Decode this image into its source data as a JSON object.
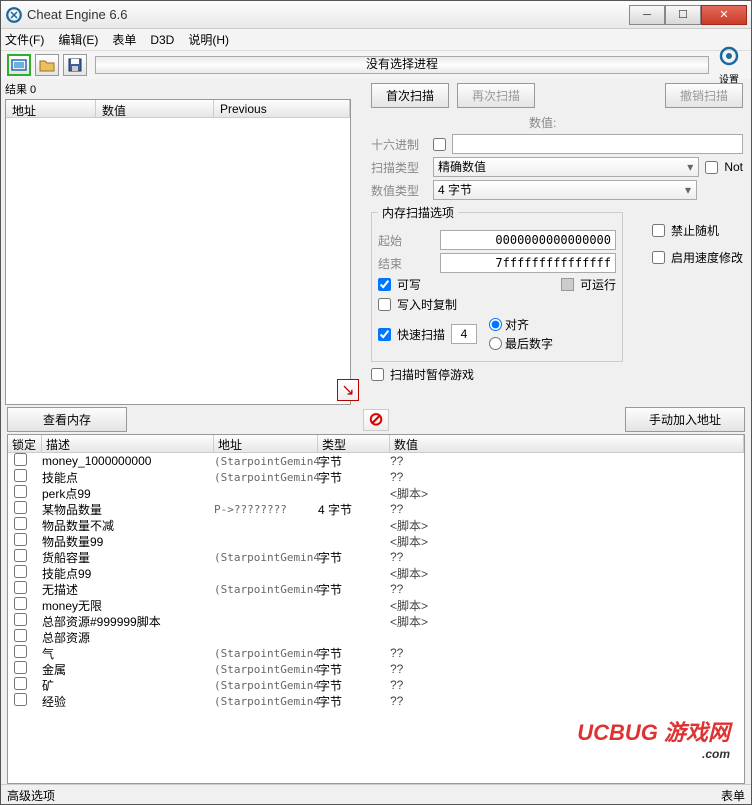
{
  "window": {
    "title": "Cheat Engine 6.6"
  },
  "menu": {
    "file": "文件(F)",
    "edit": "编辑(E)",
    "table": "表单",
    "d3d": "D3D",
    "help": "说明(H)"
  },
  "toolbar": {
    "progress_text": "没有选择进程",
    "settings": "设置"
  },
  "results": {
    "label": "结果 0",
    "col_addr": "地址",
    "col_val": "数值",
    "col_prev": "Previous"
  },
  "scan": {
    "first": "首次扫描",
    "next": "再次扫描",
    "undo": "撤销扫描",
    "value_label": "数值:",
    "hex": "十六进制",
    "scantype_label": "扫描类型",
    "scantype_value": "精确数值",
    "valuetype_label": "数值类型",
    "valuetype_value": "4 字节",
    "not": "Not",
    "mem_legend": "内存扫描选项",
    "start_label": "起始",
    "start_value": "0000000000000000",
    "stop_label": "结束",
    "stop_value": "7fffffffffffffff",
    "writable": "可写",
    "executable": "可运行",
    "copyonwrite": "写入时复制",
    "fastscan": "快速扫描",
    "fastscan_val": "4",
    "align": "对齐",
    "lastdigit": "最后数字",
    "pause": "扫描时暂停游戏",
    "norandom": "禁止随机",
    "speedhack": "启用速度修改"
  },
  "bottom": {
    "view_mem": "查看内存",
    "add_manual": "手动加入地址"
  },
  "cheat_table": {
    "hdr_lock": "锁定",
    "hdr_desc": "描述",
    "hdr_addr": "地址",
    "hdr_type": "类型",
    "hdr_val": "数值",
    "rows": [
      {
        "indent": 0,
        "desc": "money_1000000000",
        "addr": "(StarpointGemin4",
        "type": "字节",
        "val": "??"
      },
      {
        "indent": 0,
        "desc": "技能点",
        "addr": "(StarpointGemin4",
        "type": "字节",
        "val": "??"
      },
      {
        "indent": 0,
        "desc": "perk点99",
        "addr": "",
        "type": "",
        "val": "<脚本>"
      },
      {
        "indent": 0,
        "desc": "某物品数量",
        "addr": "P->????????",
        "type": "4 字节",
        "val": "??"
      },
      {
        "indent": 0,
        "desc": "物品数量不减",
        "addr": "",
        "type": "",
        "val": "<脚本>"
      },
      {
        "indent": 0,
        "desc": "物品数量99",
        "addr": "",
        "type": "",
        "val": "<脚本>"
      },
      {
        "indent": 0,
        "desc": "货船容量",
        "addr": "(StarpointGemin4",
        "type": "字节",
        "val": "??"
      },
      {
        "indent": 0,
        "desc": "技能点99",
        "addr": "",
        "type": "",
        "val": "<脚本>"
      },
      {
        "indent": 0,
        "desc": "无描述",
        "addr": "(StarpointGemin4",
        "type": "字节",
        "val": "??"
      },
      {
        "indent": 0,
        "desc": "money无限",
        "addr": "",
        "type": "",
        "val": "<脚本>"
      },
      {
        "indent": 0,
        "desc": "总部资源#999999脚本",
        "addr": "",
        "type": "",
        "val": "<脚本>"
      },
      {
        "indent": 0,
        "desc": "总部资源",
        "addr": "",
        "type": "",
        "val": ""
      },
      {
        "indent": 1,
        "desc": "气",
        "addr": "(StarpointGemin4",
        "type": "字节",
        "val": "??"
      },
      {
        "indent": 1,
        "desc": "金属",
        "addr": "(StarpointGemin4",
        "type": "字节",
        "val": "??"
      },
      {
        "indent": 1,
        "desc": "矿",
        "addr": "(StarpointGemin4",
        "type": "字节",
        "val": "??"
      },
      {
        "indent": 0,
        "desc": "经验",
        "addr": "(StarpointGemin4",
        "type": "字节",
        "val": "??"
      }
    ]
  },
  "status": {
    "advanced": "高级选项",
    "table_extra": "表单"
  },
  "watermark": {
    "main": "UCBUG 游戏网",
    "sub": ".com"
  }
}
